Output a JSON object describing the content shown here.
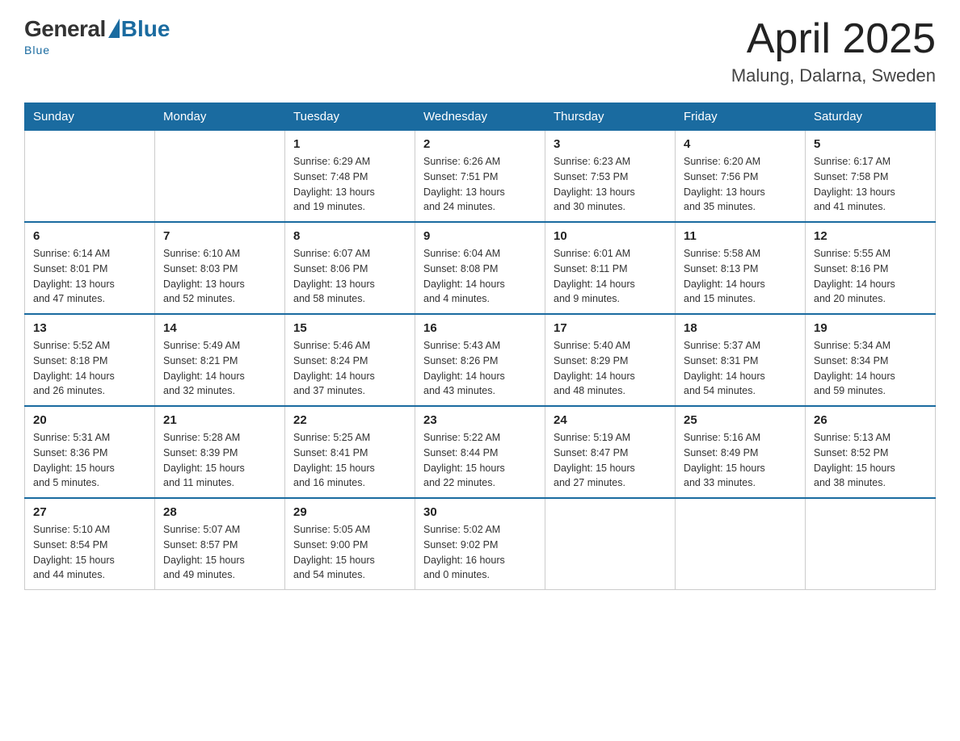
{
  "header": {
    "logo": {
      "general": "General",
      "blue": "Blue",
      "subtitle": "Blue"
    },
    "title": "April 2025",
    "location": "Malung, Dalarna, Sweden"
  },
  "weekdays": [
    "Sunday",
    "Monday",
    "Tuesday",
    "Wednesday",
    "Thursday",
    "Friday",
    "Saturday"
  ],
  "weeks": [
    [
      {
        "day": "",
        "info": ""
      },
      {
        "day": "",
        "info": ""
      },
      {
        "day": "1",
        "info": "Sunrise: 6:29 AM\nSunset: 7:48 PM\nDaylight: 13 hours\nand 19 minutes."
      },
      {
        "day": "2",
        "info": "Sunrise: 6:26 AM\nSunset: 7:51 PM\nDaylight: 13 hours\nand 24 minutes."
      },
      {
        "day": "3",
        "info": "Sunrise: 6:23 AM\nSunset: 7:53 PM\nDaylight: 13 hours\nand 30 minutes."
      },
      {
        "day": "4",
        "info": "Sunrise: 6:20 AM\nSunset: 7:56 PM\nDaylight: 13 hours\nand 35 minutes."
      },
      {
        "day": "5",
        "info": "Sunrise: 6:17 AM\nSunset: 7:58 PM\nDaylight: 13 hours\nand 41 minutes."
      }
    ],
    [
      {
        "day": "6",
        "info": "Sunrise: 6:14 AM\nSunset: 8:01 PM\nDaylight: 13 hours\nand 47 minutes."
      },
      {
        "day": "7",
        "info": "Sunrise: 6:10 AM\nSunset: 8:03 PM\nDaylight: 13 hours\nand 52 minutes."
      },
      {
        "day": "8",
        "info": "Sunrise: 6:07 AM\nSunset: 8:06 PM\nDaylight: 13 hours\nand 58 minutes."
      },
      {
        "day": "9",
        "info": "Sunrise: 6:04 AM\nSunset: 8:08 PM\nDaylight: 14 hours\nand 4 minutes."
      },
      {
        "day": "10",
        "info": "Sunrise: 6:01 AM\nSunset: 8:11 PM\nDaylight: 14 hours\nand 9 minutes."
      },
      {
        "day": "11",
        "info": "Sunrise: 5:58 AM\nSunset: 8:13 PM\nDaylight: 14 hours\nand 15 minutes."
      },
      {
        "day": "12",
        "info": "Sunrise: 5:55 AM\nSunset: 8:16 PM\nDaylight: 14 hours\nand 20 minutes."
      }
    ],
    [
      {
        "day": "13",
        "info": "Sunrise: 5:52 AM\nSunset: 8:18 PM\nDaylight: 14 hours\nand 26 minutes."
      },
      {
        "day": "14",
        "info": "Sunrise: 5:49 AM\nSunset: 8:21 PM\nDaylight: 14 hours\nand 32 minutes."
      },
      {
        "day": "15",
        "info": "Sunrise: 5:46 AM\nSunset: 8:24 PM\nDaylight: 14 hours\nand 37 minutes."
      },
      {
        "day": "16",
        "info": "Sunrise: 5:43 AM\nSunset: 8:26 PM\nDaylight: 14 hours\nand 43 minutes."
      },
      {
        "day": "17",
        "info": "Sunrise: 5:40 AM\nSunset: 8:29 PM\nDaylight: 14 hours\nand 48 minutes."
      },
      {
        "day": "18",
        "info": "Sunrise: 5:37 AM\nSunset: 8:31 PM\nDaylight: 14 hours\nand 54 minutes."
      },
      {
        "day": "19",
        "info": "Sunrise: 5:34 AM\nSunset: 8:34 PM\nDaylight: 14 hours\nand 59 minutes."
      }
    ],
    [
      {
        "day": "20",
        "info": "Sunrise: 5:31 AM\nSunset: 8:36 PM\nDaylight: 15 hours\nand 5 minutes."
      },
      {
        "day": "21",
        "info": "Sunrise: 5:28 AM\nSunset: 8:39 PM\nDaylight: 15 hours\nand 11 minutes."
      },
      {
        "day": "22",
        "info": "Sunrise: 5:25 AM\nSunset: 8:41 PM\nDaylight: 15 hours\nand 16 minutes."
      },
      {
        "day": "23",
        "info": "Sunrise: 5:22 AM\nSunset: 8:44 PM\nDaylight: 15 hours\nand 22 minutes."
      },
      {
        "day": "24",
        "info": "Sunrise: 5:19 AM\nSunset: 8:47 PM\nDaylight: 15 hours\nand 27 minutes."
      },
      {
        "day": "25",
        "info": "Sunrise: 5:16 AM\nSunset: 8:49 PM\nDaylight: 15 hours\nand 33 minutes."
      },
      {
        "day": "26",
        "info": "Sunrise: 5:13 AM\nSunset: 8:52 PM\nDaylight: 15 hours\nand 38 minutes."
      }
    ],
    [
      {
        "day": "27",
        "info": "Sunrise: 5:10 AM\nSunset: 8:54 PM\nDaylight: 15 hours\nand 44 minutes."
      },
      {
        "day": "28",
        "info": "Sunrise: 5:07 AM\nSunset: 8:57 PM\nDaylight: 15 hours\nand 49 minutes."
      },
      {
        "day": "29",
        "info": "Sunrise: 5:05 AM\nSunset: 9:00 PM\nDaylight: 15 hours\nand 54 minutes."
      },
      {
        "day": "30",
        "info": "Sunrise: 5:02 AM\nSunset: 9:02 PM\nDaylight: 16 hours\nand 0 minutes."
      },
      {
        "day": "",
        "info": ""
      },
      {
        "day": "",
        "info": ""
      },
      {
        "day": "",
        "info": ""
      }
    ]
  ]
}
